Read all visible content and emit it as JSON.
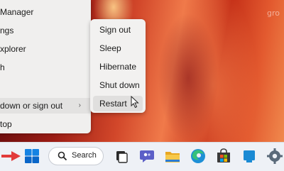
{
  "wallpaper": {
    "watermark": "gro"
  },
  "winx_menu": {
    "items": [
      {
        "label": "Manager"
      },
      {
        "label": "ngs"
      },
      {
        "label": "xplorer"
      },
      {
        "label": "h"
      },
      {
        "label": "down or sign out"
      },
      {
        "label": "top"
      }
    ],
    "chevron": "›"
  },
  "shutdown_submenu": {
    "items": [
      {
        "label": "Sign out"
      },
      {
        "label": "Sleep"
      },
      {
        "label": "Hibernate"
      },
      {
        "label": "Shut down"
      },
      {
        "label": "Restart"
      }
    ],
    "hovered": "Restart"
  },
  "taskbar": {
    "search_label": "Search",
    "icons": [
      "arrow-annotation",
      "windows-start-icon",
      "search-icon",
      "task-view-icon",
      "teams-chat-icon",
      "file-explorer-icon",
      "edge-icon",
      "microsoft-store-icon",
      "pinned-app-icon",
      "settings-icon"
    ],
    "colors": {
      "start": "#0a74d8",
      "arrow": "#e23b3b",
      "chat": "#5b5fc7",
      "folder": "#f4c23e",
      "edge": "#1d8fd6"
    }
  }
}
